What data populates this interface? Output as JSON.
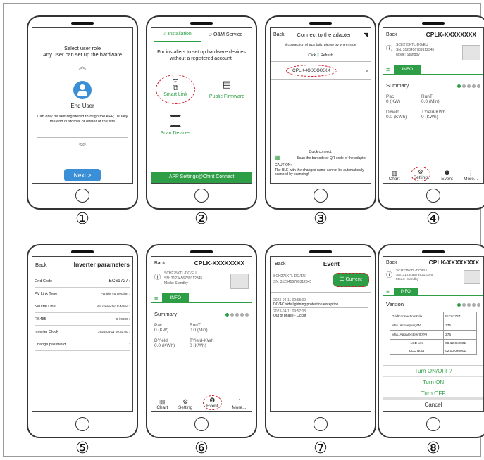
{
  "steps": [
    "①",
    "②",
    "③",
    "④",
    "⑤",
    "⑥",
    "⑦",
    "⑧"
  ],
  "s1": {
    "title": "Select user role",
    "subtitle": "Any user can set up the hardware",
    "role": "End User",
    "desc": "Can only be self-registered through the APP, usually the end customer or owner of the site",
    "next": "Next",
    "next_icon": ">"
  },
  "s2": {
    "tab1": "Installation",
    "tab2": "O&M Service",
    "desc": "For installers to set up hardware devices without a registered account.",
    "smart": "Smart Link",
    "firmware": "Public Firmware",
    "scan": "Scan Devices",
    "footer": "APP Settings@Chint Connect"
  },
  "s3": {
    "back": "Back",
    "title": "Connect to the adapter",
    "hint": "If connection of BLE fails, please try WIFI mode",
    "click": "Click",
    "refresh": "Refresh",
    "device": "CPLK-XXXXXXXX",
    "quick": "Quick connect:",
    "scan": "Scan the barcode or QR code of the adapter",
    "caution_title": "CAUTION:",
    "caution": "The BLE with the changed name cannot be automatically scanned by scanning!"
  },
  "dev": {
    "back": "Back",
    "title": "CPLK-XXXXXXXX",
    "model": "SCH275KTL-DO/EU",
    "sn": "SN: 3123456789312345",
    "mode": "Mode: Standby",
    "info": "INFO",
    "summary": "Summary",
    "version": "Version",
    "pac": "Pac",
    "runt": "RunT",
    "pac_val": "0 (KW)",
    "runt_val": "0.0 (Min)",
    "dyield": "DYield",
    "tyield": "TYield-KWh",
    "dyield_val": "0.0 (KWh)",
    "tyield_val": "0 (KWh)",
    "nav": [
      "Chart",
      "Setting",
      "Event",
      "More..."
    ]
  },
  "s5": {
    "back": "Back",
    "title": "Inverter parameters",
    "rows": [
      {
        "label": "Grid Code",
        "value": "IEC61727"
      },
      {
        "label": "PV Link Type",
        "value": "Parallel connection"
      },
      {
        "label": "Neutral Line",
        "value": "Not connected to N line"
      },
      {
        "label": "RS485",
        "value": "5 / 9600"
      },
      {
        "label": "Inverter Clock",
        "value": "2023-04-11 09:31:00"
      },
      {
        "label": "Change password",
        "value": ""
      }
    ]
  },
  "s7": {
    "back": "Back",
    "title": "Event",
    "model": "SCH275KTL-DO/EU",
    "sn": "SN: 3123456789312345",
    "current": "Current",
    "events": [
      {
        "time": "2023-04-11 09:58:09",
        "text": "DC/AC side lightning protection exception"
      },
      {
        "time": "2023-04-11 09:57:08",
        "text": "Out of phase - Occur"
      }
    ]
  },
  "s8": {
    "table": [
      {
        "k": "GridConnectionRule",
        "v": "IEC61727"
      },
      {
        "k": "Max. Activepwr(kW)",
        "v": "275"
      },
      {
        "k": "Max. Apparentpwr(kVA)",
        "v": "275"
      },
      {
        "k": "LCD Ver",
        "v": "08.12.0x0001"
      },
      {
        "k": "LCD Boot",
        "v": "02.00.0x0001"
      }
    ],
    "sheet_title": "Turn ON/OFF?",
    "on": "Turn ON",
    "off": "Turn OFF",
    "cancel": "Cancel"
  },
  "colors": {
    "accent": "#2e9e46",
    "highlight": "#d0202a",
    "button": "#3a8fd6"
  }
}
